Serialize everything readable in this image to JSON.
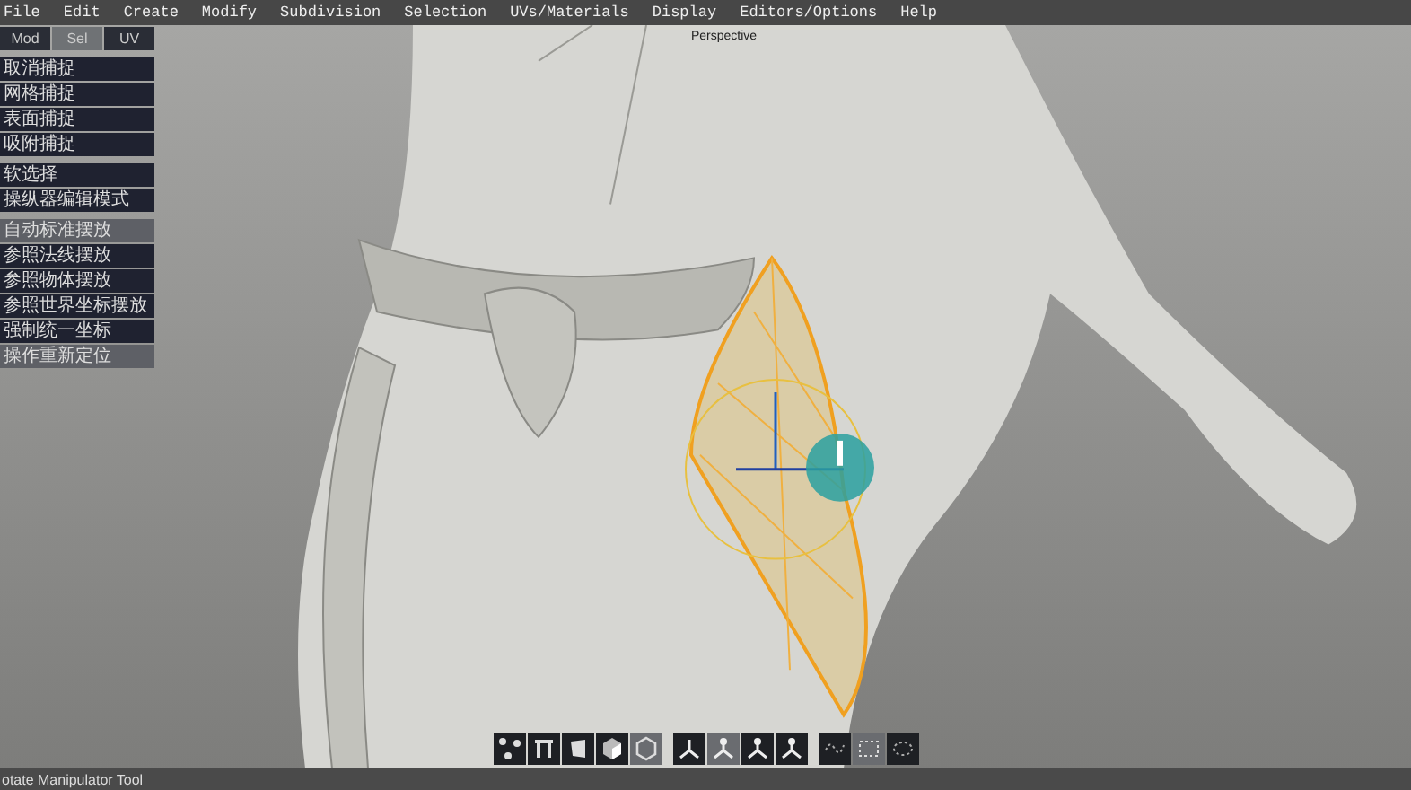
{
  "menu": [
    "File",
    "Edit",
    "Create",
    "Modify",
    "Subdivision",
    "Selection",
    "UVs/Materials",
    "Display",
    "Editors/Options",
    "Help"
  ],
  "viewport": {
    "label": "Perspective"
  },
  "panel": {
    "tabs": [
      {
        "label": "Mod",
        "selected": false
      },
      {
        "label": "Sel",
        "selected": true
      },
      {
        "label": "UV",
        "selected": false
      }
    ],
    "groups": [
      {
        "items": [
          {
            "label": "取消捕捉",
            "selected": false
          },
          {
            "label": "网格捕捉",
            "selected": false
          },
          {
            "label": "表面捕捉",
            "selected": false
          },
          {
            "label": "吸附捕捉",
            "selected": false
          }
        ]
      },
      {
        "items": [
          {
            "label": "软选择",
            "selected": false
          },
          {
            "label": "操纵器编辑模式",
            "selected": false
          }
        ]
      },
      {
        "items": [
          {
            "label": "自动标准摆放",
            "selected": true
          },
          {
            "label": "参照法线摆放",
            "selected": false
          },
          {
            "label": "参照物体摆放",
            "selected": false
          },
          {
            "label": "参照世界坐标摆放",
            "selected": false
          },
          {
            "label": "强制统一坐标",
            "selected": false
          },
          {
            "label": "操作重新定位",
            "selected": true
          }
        ]
      }
    ]
  },
  "toolbar": {
    "groups": [
      {
        "buttons": [
          {
            "kind": "vertex",
            "selected": false
          },
          {
            "kind": "edge",
            "selected": false
          },
          {
            "kind": "face",
            "selected": false
          },
          {
            "kind": "object",
            "selected": false
          },
          {
            "kind": "polygon",
            "selected": true
          }
        ]
      },
      {
        "buttons": [
          {
            "kind": "move",
            "selected": false
          },
          {
            "kind": "rotate",
            "selected": true
          },
          {
            "kind": "scale",
            "selected": false
          },
          {
            "kind": "universal",
            "selected": false
          }
        ]
      },
      {
        "buttons": [
          {
            "kind": "lasso",
            "selected": false
          },
          {
            "kind": "rect",
            "selected": true
          },
          {
            "kind": "paint",
            "selected": false
          }
        ]
      }
    ]
  },
  "status_bar": {
    "text": "otate Manipulator Tool"
  }
}
